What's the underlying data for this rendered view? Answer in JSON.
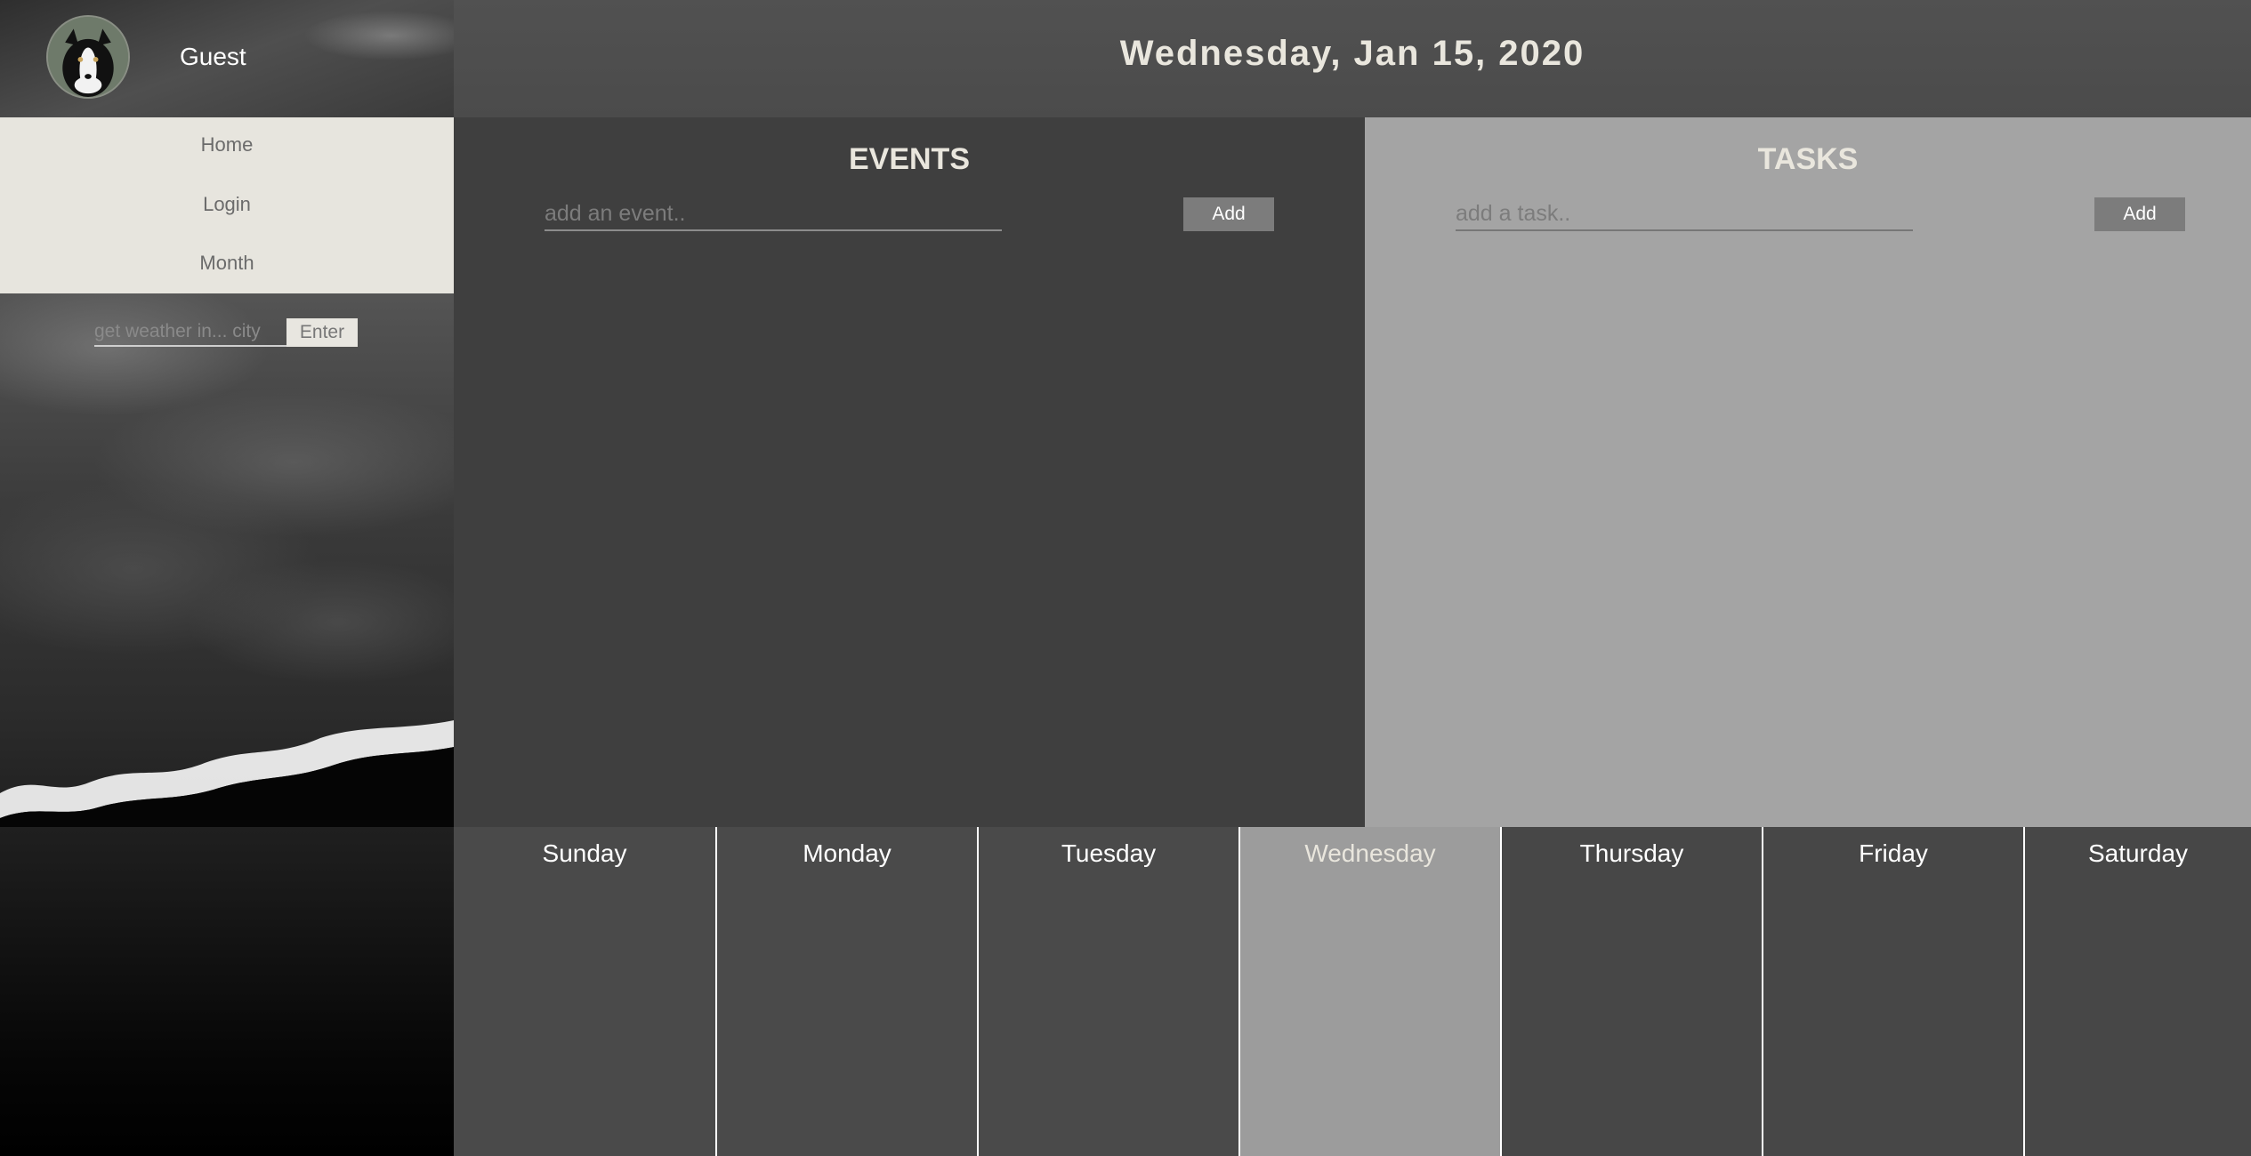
{
  "sidebar": {
    "user_name": "Guest",
    "nav": [
      {
        "label": "Home"
      },
      {
        "label": "Login"
      },
      {
        "label": "Month"
      }
    ],
    "weather": {
      "placeholder": "get weather in... city",
      "button_label": "Enter"
    }
  },
  "header": {
    "date": "Wednesday, Jan 15, 2020"
  },
  "events": {
    "title": "EVENTS",
    "placeholder": "add an event..",
    "button_label": "Add"
  },
  "tasks": {
    "title": "TASKS",
    "placeholder": "add a task..",
    "button_label": "Add"
  },
  "week": {
    "days": [
      {
        "label": "Sunday",
        "color": "#4a4a4a"
      },
      {
        "label": "Monday",
        "color": "#4a4a4a"
      },
      {
        "label": "Tuesday",
        "color": "#4a4a4a"
      },
      {
        "label": "Wednesday",
        "color": "#9c9c9c",
        "active": true
      },
      {
        "label": "Thursday",
        "color": "#474747"
      },
      {
        "label": "Friday",
        "color": "#474747"
      },
      {
        "label": "Saturday",
        "color": "#474747"
      }
    ]
  },
  "colors": {
    "accent_light": "#e7e5de",
    "button_gray": "#7c7c7c",
    "events_bg": "#3f3f3f",
    "tasks_bg": "#a4a4a4"
  }
}
